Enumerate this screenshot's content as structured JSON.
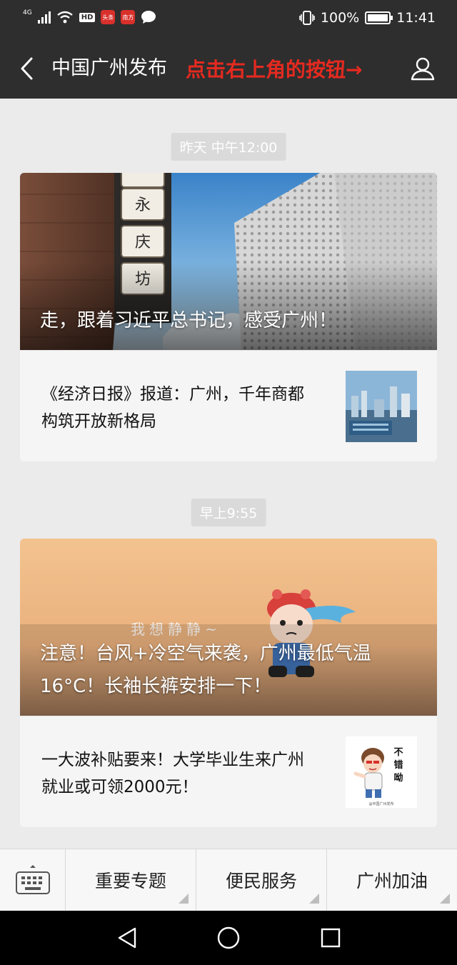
{
  "status_bar": {
    "network": "4G",
    "hd_label": "HD",
    "app_badges": [
      "头条",
      "南方"
    ],
    "battery_percent_text": "100%",
    "time": "11:41"
  },
  "header": {
    "title": "中国广州发布",
    "overlay_hint": "点击右上角的按钮→"
  },
  "messages": [
    {
      "timestamp": "昨天 中午12:00",
      "hero_title": "走，跟着习近平总书记，感受广州！",
      "sign_chars": [
        "永",
        "庆",
        "坊"
      ],
      "item_text": "《经济日报》报道：广州，千年商都构筑开放新格局"
    },
    {
      "timestamp": "早上9:55",
      "hero_title": "注意！台风+冷空气来袭，广州最低气温16°C！长袖长裤安排一下！",
      "sticker_caption": "我想静静~",
      "item_text": "一大波补贴要来！大学毕业生来广州就业或可领2000元！",
      "thumb_caption": "不错呦",
      "thumb_watermark": "@中国广州发布"
    }
  ],
  "bottom_menu": {
    "items": [
      "重要专题",
      "便民服务",
      "广州加油"
    ]
  },
  "colors": {
    "header_bg": "#2e2e2e",
    "overlay_hint": "#e52a20",
    "page_bg": "#ebebeb"
  }
}
